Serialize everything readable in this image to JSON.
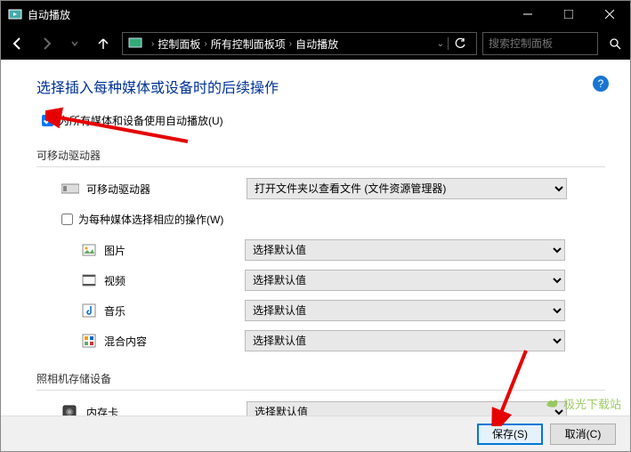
{
  "window": {
    "title": "自动播放"
  },
  "breadcrumb": {
    "root": "控制面板",
    "mid": "所有控制面板项",
    "leaf": "自动播放"
  },
  "search": {
    "placeholder": "搜索控制面板"
  },
  "page": {
    "heading": "选择插入每种媒体或设备时的后续操作",
    "master_checkbox": "为所有媒体和设备使用自动播放(U)",
    "section_removable": "可移动驱动器",
    "removable_drive_label": "可移动驱动器",
    "removable_drive_value": "打开文件夹以查看文件 (文件资源管理器)",
    "per_media_checkbox": "为每种媒体选择相应的操作(W)",
    "media": {
      "pictures": {
        "label": "图片",
        "value": "选择默认值"
      },
      "videos": {
        "label": "视频",
        "value": "选择默认值"
      },
      "music": {
        "label": "音乐",
        "value": "选择默认值"
      },
      "mixed": {
        "label": "混合内容",
        "value": "选择默认值"
      }
    },
    "section_camera": "照相机存储设备",
    "memory_card_label": "内存卡",
    "memory_card_value": "选择默认值"
  },
  "footer": {
    "save": "保存(S)",
    "cancel": "取消(C)"
  },
  "watermark": "极光下载站"
}
